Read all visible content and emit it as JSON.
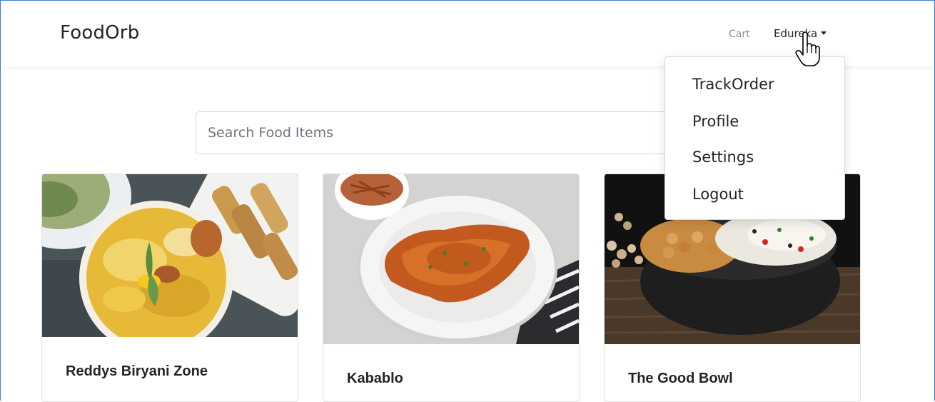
{
  "brand": "FoodOrb",
  "nav": {
    "cart": "Cart",
    "user": "Edureka"
  },
  "search": {
    "placeholder": "Search Food Items"
  },
  "dropdown": {
    "items": [
      "TrackOrder",
      "Profile",
      "Settings",
      "Logout"
    ]
  },
  "restaurants": [
    {
      "name": "Reddys Biryani Zone"
    },
    {
      "name": "Kabablo"
    },
    {
      "name": "The Good Bowl"
    }
  ]
}
